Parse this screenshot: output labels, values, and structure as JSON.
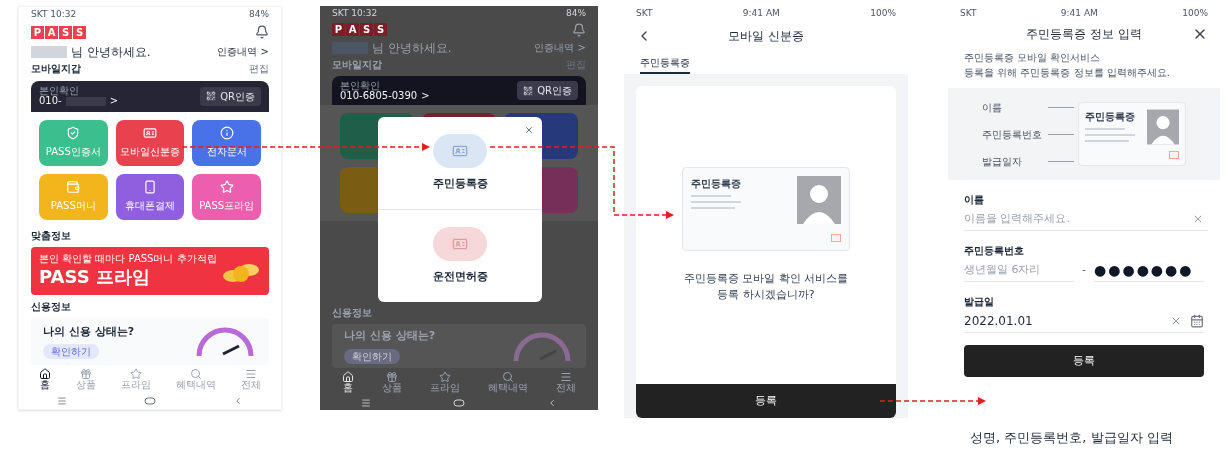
{
  "home_screen": {
    "status_time": "SKT 10:32",
    "battery": "84%",
    "logo": [
      "P",
      "A",
      "S",
      "S"
    ],
    "greeting": "님 안녕하세요.",
    "history_link": "인증내역 >",
    "wallet_title": "모바일지갑",
    "wallet_edit": "편집",
    "card_label": "본인확인",
    "phone": "010-",
    "phone_suffix": ">",
    "qr_button": "QR인증",
    "tiles": [
      {
        "label": "PASS인증서",
        "color": "#3cbf8f"
      },
      {
        "label": "모바일신분증",
        "color": "#e8424f"
      },
      {
        "label": "전자문서",
        "color": "#4a72e8"
      },
      {
        "label": "PASS머니",
        "color": "#f2b61c"
      },
      {
        "label": "휴대폰결제",
        "color": "#8f5fe0"
      },
      {
        "label": "PASS프라임",
        "color": "#ec5fae"
      }
    ],
    "section_custom": "맞춤정보",
    "banner": {
      "caption": "본인 확인할 때마다 PASS머니 추가적립",
      "title": "PASS 프라임"
    },
    "section_credit": "신용정보",
    "credit_title": "나의 신용 상태는?",
    "credit_button": "확인하기",
    "nav": [
      {
        "label": "홈",
        "selected": true
      },
      {
        "label": "상품",
        "selected": false
      },
      {
        "label": "프라임",
        "selected": false
      },
      {
        "label": "혜택내역",
        "selected": false
      },
      {
        "label": "전체",
        "selected": false
      }
    ]
  },
  "popup_screen": {
    "status_time": "SKT 10:32",
    "battery": "84%",
    "logo": [
      "P",
      "A",
      "S",
      "S"
    ],
    "greeting": "님 안녕하세요.",
    "history_link": "인증내역 >",
    "wallet_title": "모바일지갑",
    "wallet_edit": "편집",
    "card_label": "본인확인",
    "phone": "010-6805-0390",
    "phone_suffix": ">",
    "qr_button": "QR인증",
    "options": [
      {
        "label": "주민등록증",
        "kind": "id"
      },
      {
        "label": "운전면허증",
        "kind": "license"
      }
    ],
    "section_credit": "신용정보",
    "credit_title": "나의 신용 상태는?",
    "credit_button": "확인하기",
    "nav": [
      {
        "label": "홈",
        "selected": true
      },
      {
        "label": "상품",
        "selected": false
      },
      {
        "label": "프라임",
        "selected": false
      },
      {
        "label": "혜택내역",
        "selected": false
      },
      {
        "label": "전체",
        "selected": false
      }
    ]
  },
  "id_screen": {
    "carrier": "SKT",
    "time": "9:41 AM",
    "battery": "100%",
    "title": "모바일 신분증",
    "tabs": [
      {
        "label": "주민등록증",
        "selected": true
      }
    ],
    "card_title": "주민등록증",
    "question": [
      "주민등록증 모바일 확인 서비스를",
      "등록 하시겠습니까?"
    ],
    "register_button": "등록"
  },
  "form_screen": {
    "carrier": "SKT",
    "time": "9:41 AM",
    "battery": "100%",
    "title": "주민등록증 정보 입력",
    "intro": [
      "주민등록증 모바일 확인서비스",
      "등록을 위해 주민등록증 정보를 입력해주세요."
    ],
    "diagram_labels": [
      "이름",
      "주민등록번호",
      "발급일자"
    ],
    "card_title": "주민등록증",
    "name_label": "이름",
    "name_placeholder": "이름을 입력해주세요.",
    "rrn_label": "주민등록번호",
    "rrn_placeholder": "생년월일 6자리",
    "rrn_dash": "-",
    "rrn_back": "●●●●●●●",
    "date_label": "발급일",
    "date_value": "2022.01.01",
    "register_button": "등록"
  },
  "caption": "성명, 주민등록번호, 발급일자 입력"
}
